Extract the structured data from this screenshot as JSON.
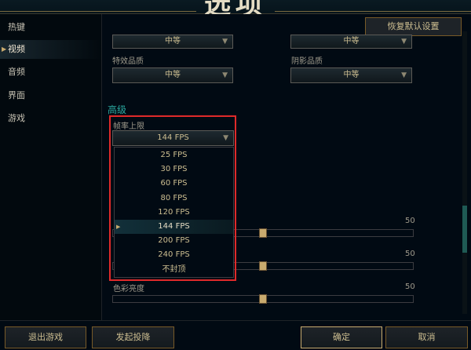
{
  "window": {
    "title": "选项"
  },
  "sidebar": {
    "items": [
      {
        "label": "热键"
      },
      {
        "label": "视频"
      },
      {
        "label": "音频"
      },
      {
        "label": "界面"
      },
      {
        "label": "游戏"
      }
    ],
    "active_index": 1
  },
  "header": {
    "reset_label": "恢复默认设置"
  },
  "settings": {
    "top_left_value": "中等",
    "top_right_value": "中等",
    "effects_quality": {
      "label": "特效品质",
      "value": "中等"
    },
    "shadow_quality": {
      "label": "阴影品质",
      "value": "中等"
    },
    "advanced_title": "高级",
    "frame_rate": {
      "label": "帧率上限",
      "value": "144 FPS",
      "options": [
        "25 FPS",
        "30 FPS",
        "60 FPS",
        "80 FPS",
        "120 FPS",
        "144 FPS",
        "200 FPS",
        "240 FPS",
        "不封顶"
      ],
      "selected_index": 5
    },
    "sliders": [
      {
        "label": "",
        "value": "50",
        "level": 0.5
      },
      {
        "label": "",
        "value": "50",
        "level": 0.5
      },
      {
        "label": "色彩亮度",
        "value": "50",
        "level": 0.5
      }
    ]
  },
  "footer": {
    "exit_label": "退出游戏",
    "surrender_label": "发起投降",
    "confirm_label": "确定",
    "cancel_label": "取消"
  },
  "colors": {
    "accent_gold": "#c8aa6e",
    "accent_teal": "#2aa9a0",
    "highlight_red": "#e02a2a"
  },
  "icons": {
    "dropdown": "chevron-down-icon",
    "nav_active": "arrow-right-icon"
  }
}
